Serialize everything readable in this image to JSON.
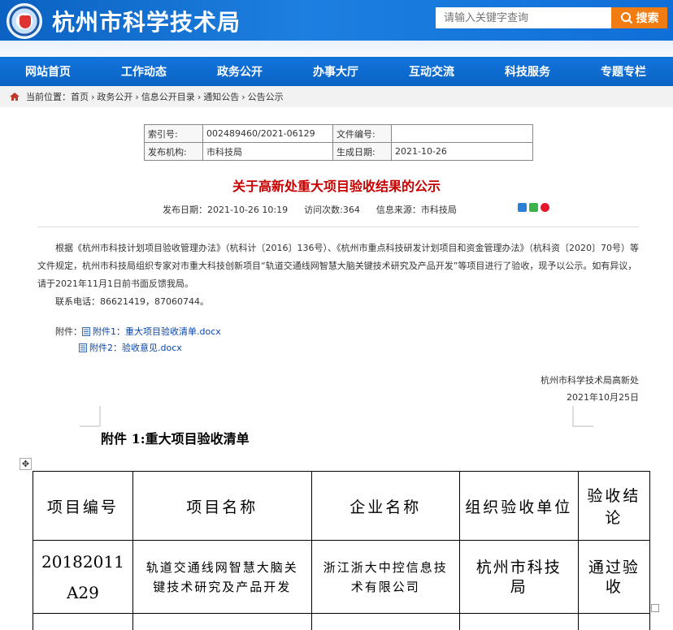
{
  "header": {
    "site_title": "杭州市科学技术局",
    "search_placeholder": "请输入关键字查询",
    "search_button": "搜索"
  },
  "nav": {
    "items": [
      "网站首页",
      "工作动态",
      "政务公开",
      "办事大厅",
      "互动交流",
      "科技服务",
      "专题专栏"
    ]
  },
  "breadcrumb": {
    "prefix": "当前位置：",
    "items": [
      "首页",
      "政务公开",
      "信息公开目录",
      "通知公告",
      "公告公示"
    ],
    "separator": "›"
  },
  "meta": {
    "index_label": "索引号:",
    "index_value": "002489460/2021-06129",
    "file_no_label": "文件编号:",
    "file_no_value": "",
    "org_label": "发布机构:",
    "org_value": "市科技局",
    "date_label": "生成日期:",
    "date_value": "2021-10-26"
  },
  "article": {
    "title": "关于高新处重大项目验收结果的公示",
    "publish_date": "发布日期：2021-10-26 10:19",
    "visits": "访问次数:364",
    "source": "信息来源：市科技局",
    "paragraph1": "根据《杭州市科技计划项目验收管理办法》（杭科计〔2016〕136号）、《杭州市重点科技研发计划项目和资金管理办法》（杭科资〔2020〕70号）等文件规定，杭州市科技局组织专家对市重大科技创新项目“轨道交通线网智慧大脑关键技术研究及产品开发”等项目进行了验收，现予以公示。如有异议，请于2021年11月1日前书面反馈我局。",
    "contact": "联系电话：86621419，87060744。",
    "attach_label": "附件：",
    "attachments": [
      "附件1：重大项目验收清单.docx",
      "附件2：验收意见.docx"
    ],
    "sign_org": "杭州市科学技术局高新处",
    "sign_date": "2021年10月25日"
  },
  "annex": {
    "title": "附件 1:重大项目验收清单",
    "move_glyph": "✥",
    "headers": [
      "项目编号",
      "项目名称",
      "企业名称",
      "组织验收单位",
      "验收结论"
    ],
    "row": {
      "code_line1": "20182011",
      "code_line2": "A29",
      "name": "轨道交通线网智慧大脑关键技术研究及产品开发",
      "company": "浙江浙大中控信息技术有限公司",
      "unit": "杭州市科技局",
      "result": "通过验收"
    }
  },
  "icons": {
    "search": "search-icon",
    "home": "home-icon",
    "doc": "doc-icon",
    "share": [
      "qzone-share-icon",
      "wechat-share-icon",
      "weibo-share-icon"
    ]
  },
  "colors": {
    "brand_blue": "#0b62c2",
    "accent_orange": "#f07c12",
    "title_red": "#c80000",
    "link_blue": "#0645ad"
  }
}
